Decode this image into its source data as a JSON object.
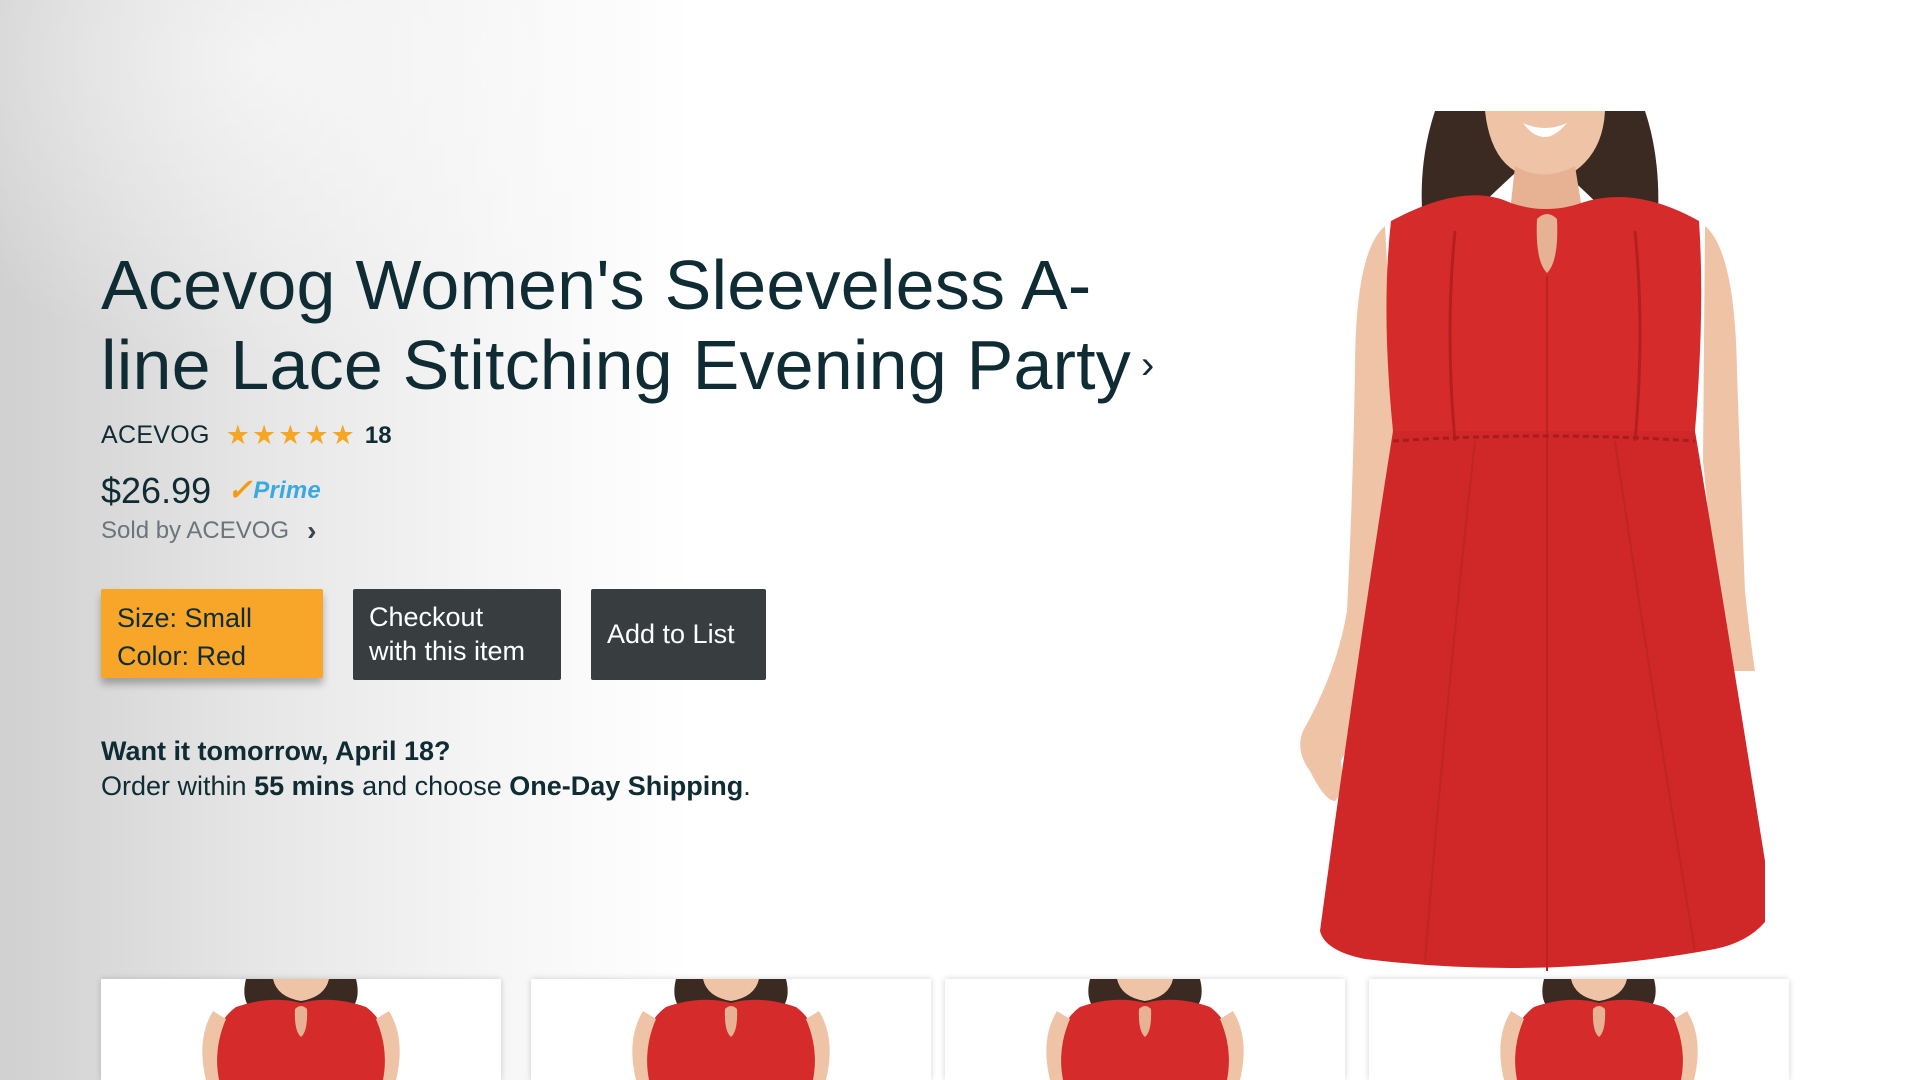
{
  "product": {
    "title": "Acevog Women's Sleeveless A-line Lace Stitching Evening Party",
    "title_chevron": "›",
    "brand": "ACEVOG",
    "rating_stars": 5,
    "review_count": "18",
    "price": "$26.99",
    "prime_check": "✓",
    "prime_label": "Prime",
    "sold_by": "Sold by ACEVOG",
    "sold_by_chevron": "›"
  },
  "buttons": {
    "variant_size": "Size: Small",
    "variant_color": "Color: Red",
    "checkout_line1": "Checkout",
    "checkout_line2": "with this item",
    "add_to_list": "Add to List"
  },
  "delivery": {
    "headline": "Want it tomorrow, April 18?",
    "prefix": "Order within ",
    "time": "55 mins",
    "middle": " and choose ",
    "method": "One-Day Shipping",
    "suffix": "."
  },
  "images": {
    "hero": "red-sleeveless-dress-front",
    "thumbnails": [
      "dress-thumb-1",
      "dress-thumb-2",
      "dress-thumb-3",
      "dress-thumb-4"
    ]
  },
  "colors": {
    "text": "#0f2b33",
    "star": "#f5a623",
    "variant_button": "#f8a62a",
    "dark_button": "#383d40",
    "prime_blue": "#39a9e0",
    "prime_orange": "#f39c12",
    "dress_red": "#d62b2b"
  }
}
